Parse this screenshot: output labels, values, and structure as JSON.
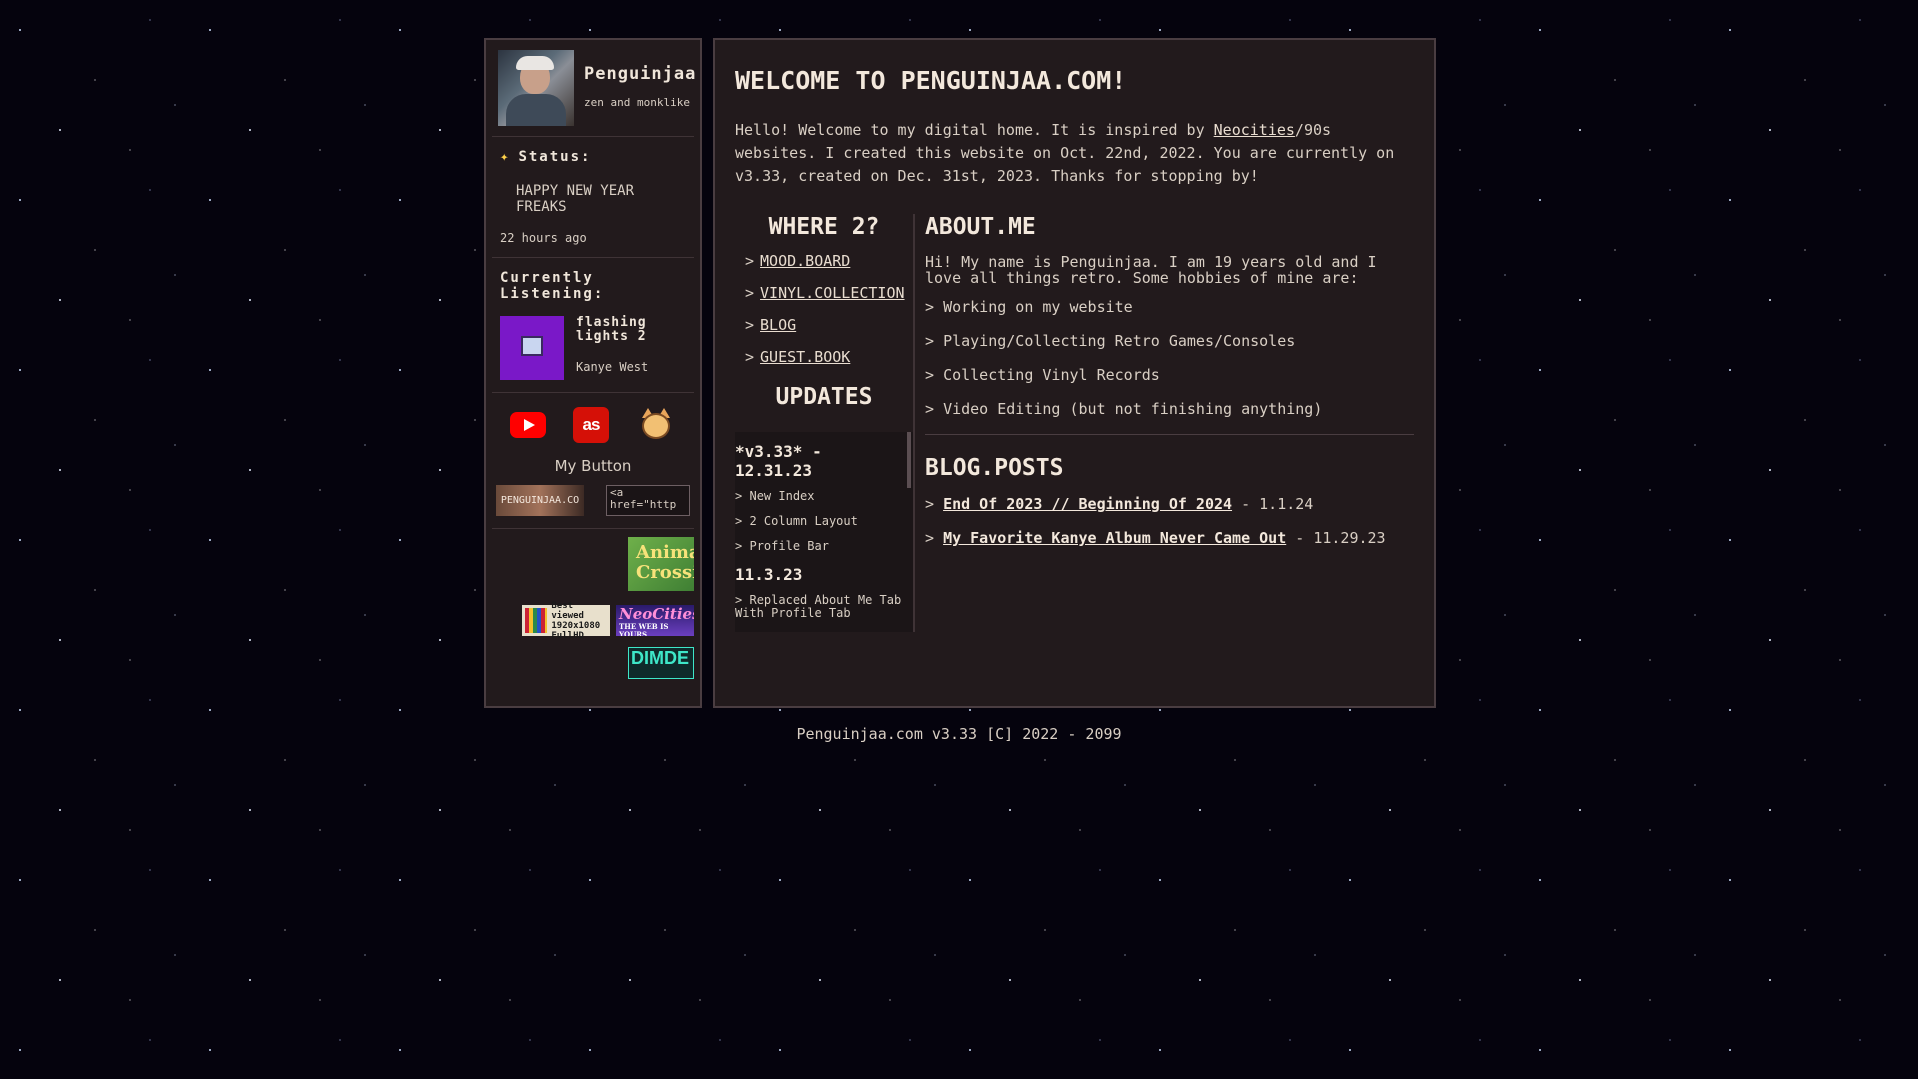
{
  "profile": {
    "username": "Penguinjaa",
    "tagline": "zen and monklike"
  },
  "status": {
    "label": "Status:",
    "text": "HAPPY NEW YEAR FREAKS",
    "time": "22 hours ago"
  },
  "listening": {
    "label": "Currently Listening:",
    "track": "flashing lights 2",
    "artist": "Kanye West"
  },
  "my_button": {
    "label": "My Button",
    "button_text": "PENGUINJAA.CO",
    "code": "<a href=\"http"
  },
  "badges": {
    "animal_crossing": "Animal Crossing",
    "hd_line1": "Best viewed",
    "hd_line2": "1920x1080",
    "hd_line3": "FullHD",
    "neocities": "NeoCities",
    "neocities_sub": "THE WEB IS YOURS",
    "dimde": "DIMDE"
  },
  "main": {
    "title": "WELCOME TO PENGUINJAA.COM!",
    "intro_before": "Hello! Welcome to my digital home. It is inspired by ",
    "intro_link": "Neocities",
    "intro_after": "/90s websites. I created this website on Oct. 22nd, 2022. You are currently on v3.33, created on Dec. 31st, 2023. Thanks for stopping by!"
  },
  "nav": {
    "title": "WHERE 2?",
    "items": [
      "MOOD.BOARD",
      "VINYL.COLLECTION",
      "BLOG",
      "GUEST.BOOK"
    ]
  },
  "updates": {
    "title": "UPDATES",
    "entries": [
      {
        "head": "*v3.33* - 12.31.23",
        "items": [
          "New Index",
          "2 Column Layout",
          "Profile Bar"
        ]
      },
      {
        "head": "11.3.23",
        "items": [
          "Replaced About Me Tab With Profile Tab"
        ]
      }
    ]
  },
  "about": {
    "title": "ABOUT.ME",
    "text": "Hi! My name is Penguinjaa. I am 19 years old and I love all things retro. Some hobbies of mine are:",
    "hobbies": [
      "Working on my website",
      "Playing/Collecting Retro Games/Consoles",
      "Collecting Vinyl Records",
      "Video Editing (but not finishing anything)"
    ]
  },
  "blog": {
    "title": "BLOG.POSTS",
    "posts": [
      {
        "title": "End Of 2023 // Beginning Of 2024",
        "date": " - 1.1.24"
      },
      {
        "title": "My Favorite Kanye Album Never Came Out",
        "date": " - 11.29.23"
      }
    ]
  },
  "footer": {
    "text": "Penguinjaa.com v3.33 [C] 2022 - 2099"
  },
  "colors": {
    "panel": "#221a1c",
    "border": "#4a3d41",
    "text": "#d9cfc4",
    "heading": "#f3e8dc",
    "album": "#7a18c8"
  },
  "icons": [
    "youtube-icon",
    "lastfm-icon",
    "cat-icon",
    "sparkle-icon"
  ],
  "arrow": ">"
}
